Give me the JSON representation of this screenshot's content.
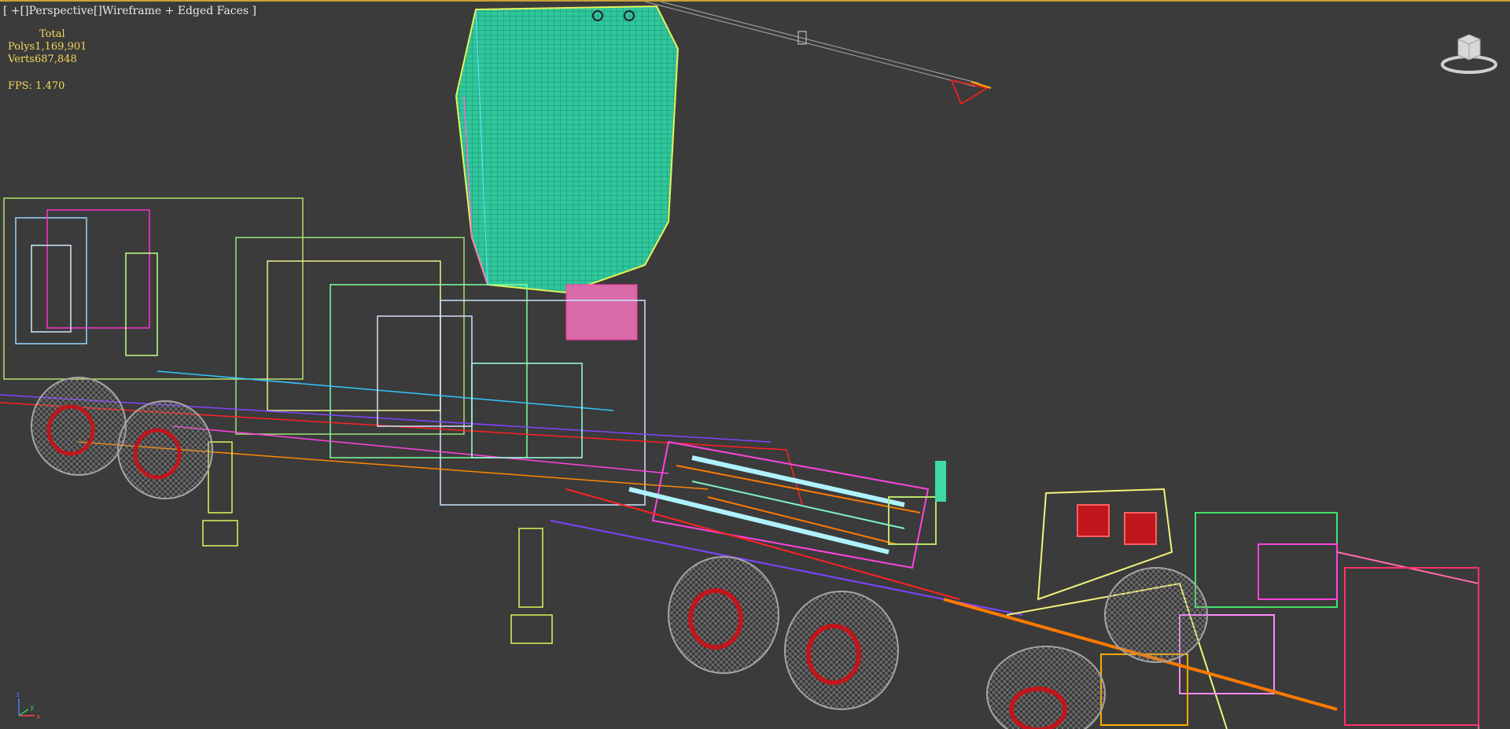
{
  "viewport": {
    "label": "[ +[]Perspective[]Wireframe + Edged Faces ]",
    "stats": {
      "total_label": "Total",
      "polys_label": "Polys",
      "polys_value": "1,169,901",
      "verts_label": "Verts",
      "verts_value": "687,848"
    },
    "fps_text": "FPS: 1.470",
    "viewcube_icon": "viewcube-icon",
    "axis_icon": "axis-tripod-icon",
    "axis_labels": {
      "x": "x",
      "y": "y",
      "z": "z"
    }
  },
  "colors": {
    "background": "#3b3b3b",
    "viewport_border": "#c8a23a",
    "stats_text": "#f5d85a",
    "label_text": "#e8e8e8",
    "wheel_rim": "#c0161c",
    "tire_mesh": "#9a9a9a",
    "antenna_panel": "#2fc79c"
  }
}
